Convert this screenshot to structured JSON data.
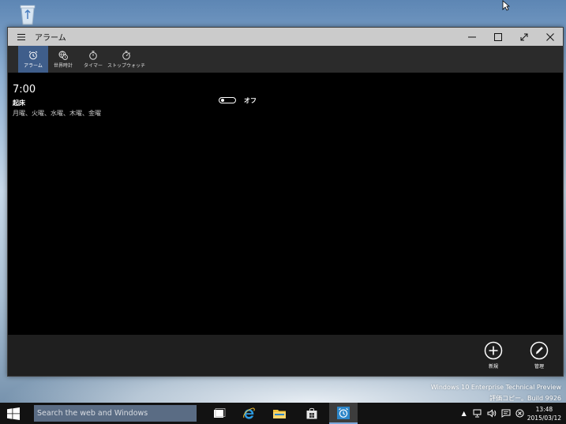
{
  "window": {
    "title": "アラーム",
    "controls": {
      "minimize": "minimize",
      "maximize": "maximize",
      "fullscreen": "fullscreen",
      "close": "close"
    }
  },
  "tabs": [
    {
      "label": "アラーム",
      "icon": "alarm-clock-icon",
      "active": true
    },
    {
      "label": "世界時計",
      "icon": "world-clock-icon",
      "active": false
    },
    {
      "label": "タイマー",
      "icon": "timer-icon",
      "active": false
    },
    {
      "label": "ストップウォッチ",
      "icon": "stopwatch-icon",
      "active": false
    }
  ],
  "alarm": {
    "time": "7:00",
    "name": "起床",
    "days": "月曜、火曜、水曜、木曜、金曜",
    "toggle_state": "オフ"
  },
  "appbar": {
    "new_label": "新規",
    "manage_label": "管理"
  },
  "watermark": {
    "line1": "Windows 10 Enterprise Technical Preview",
    "line2": "評価コピー。Build 9926"
  },
  "taskbar": {
    "search_placeholder": "Search the web and Windows",
    "time": "13:48",
    "date": "2015/03/12"
  },
  "colors": {
    "accent": "#3f5e8b",
    "titlebar": "#cbcbcb",
    "taskbar": "#121212"
  }
}
